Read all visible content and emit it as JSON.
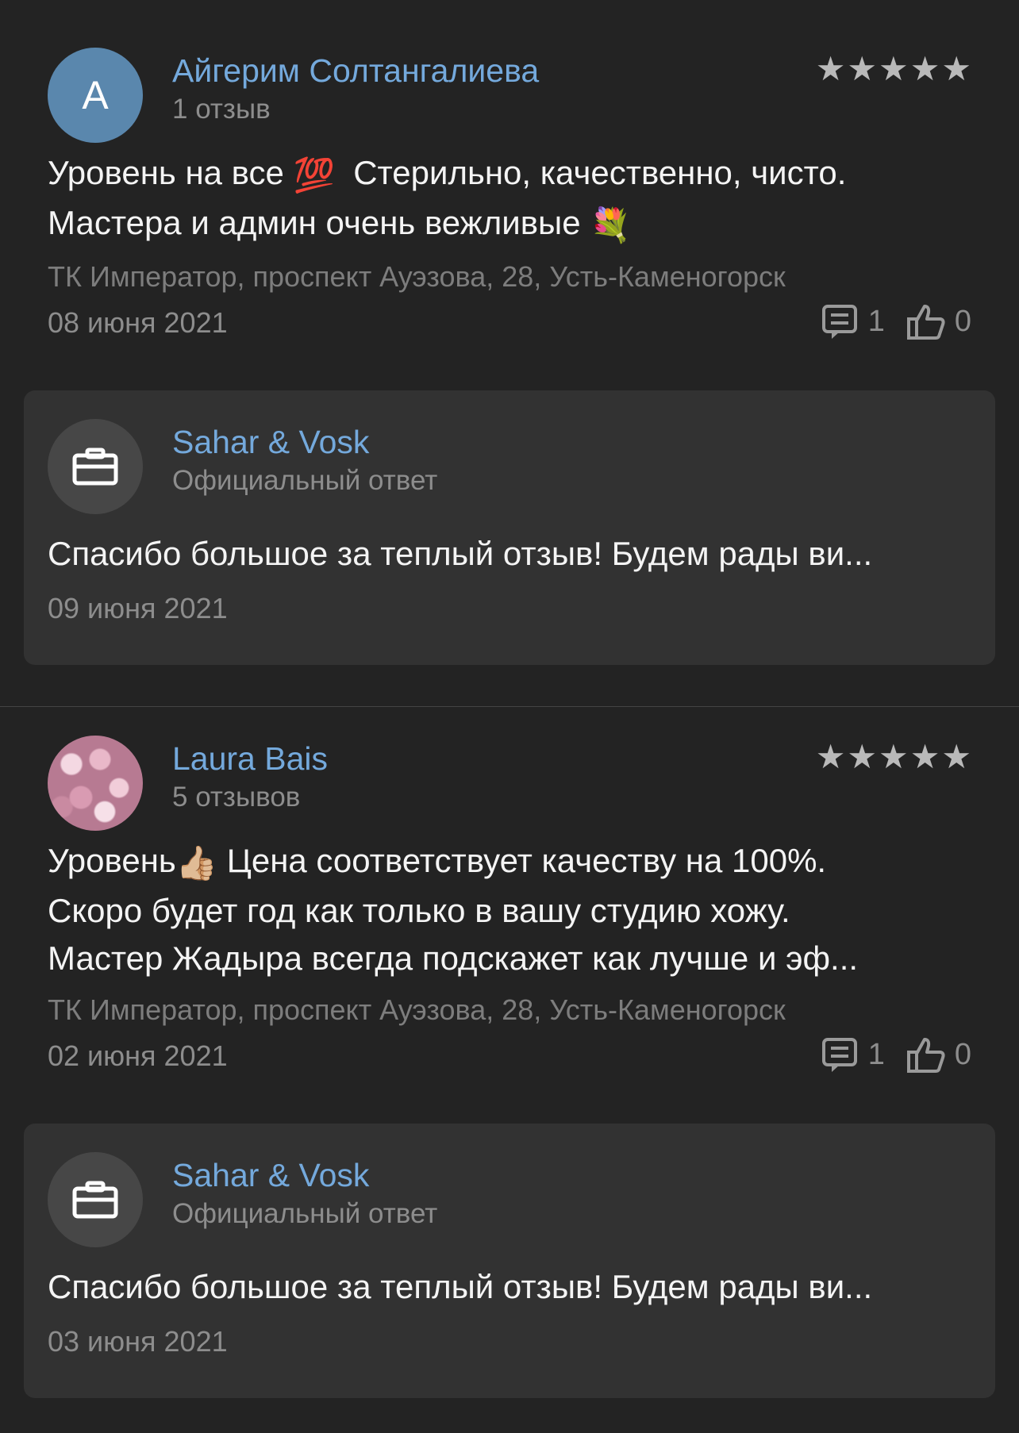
{
  "reviews": [
    {
      "author": "Айгерим Солтангалиева",
      "avatar_letter": "А",
      "review_count": "1 отзыв",
      "rating": 5,
      "text_line1_a": "Уровень на все ",
      "text_line1_b": "Стерильно, качественно, чисто.",
      "text_line2": "Мастера и админ очень вежливые ",
      "address": "ТК Император, проспект Ауэзова, 28, Усть-Каменогорск",
      "date": "08 июня 2021",
      "comments": "1",
      "likes": "0",
      "reply": {
        "business": "Sahar & Vosk",
        "label": "Официальный ответ",
        "text": "Спасибо большое за теплый отзыв! Будем рады ви...",
        "date": "09 июня 2021"
      }
    },
    {
      "author": "Laura Bais",
      "review_count": "5 отзывов",
      "rating": 5,
      "text_line1_a": "Уровень",
      "text_line1_b": " Цена соответствует качеству на 100%.",
      "text_line2": "Скоро будет год как только в вашу студию хожу.",
      "text_line3": "Мастер Жадыра всегда подскажет как лучше и эф...",
      "address": "ТК Император, проспект Ауэзова, 28, Усть-Каменогорск",
      "date": "02 июня 2021",
      "comments": "1",
      "likes": "0",
      "reply": {
        "business": "Sahar & Vosk",
        "label": "Официальный ответ",
        "text": "Спасибо большое за теплый отзыв! Будем рады ви...",
        "date": "03 июня 2021"
      }
    }
  ],
  "icons": {
    "star": "★",
    "hundred": "💯",
    "bouquet": "💐",
    "thumbs": "👍🏼"
  }
}
